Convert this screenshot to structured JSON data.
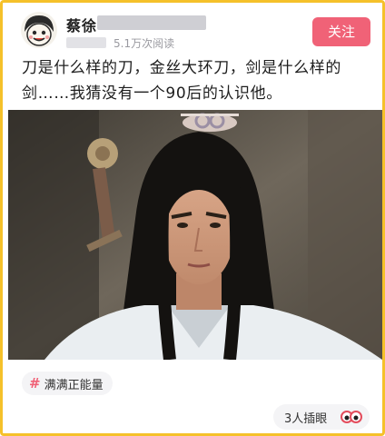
{
  "post": {
    "author_name": "蔡徐",
    "views": "5.1万次阅读",
    "follow_label": "关注",
    "text": "刀是什么样的刀，金丝大环刀，剑是什么样的剑……我猜没有一个90后的认识他。",
    "topic_label": "满满正能量",
    "reactions_label": "3人插眼"
  },
  "colors": {
    "border": "#f5c12a",
    "accent": "#f06277"
  },
  "icons": {
    "avatar": "cartoon-face-avatar",
    "topic": "hash-icon",
    "reaction": "eyes-icon"
  }
}
